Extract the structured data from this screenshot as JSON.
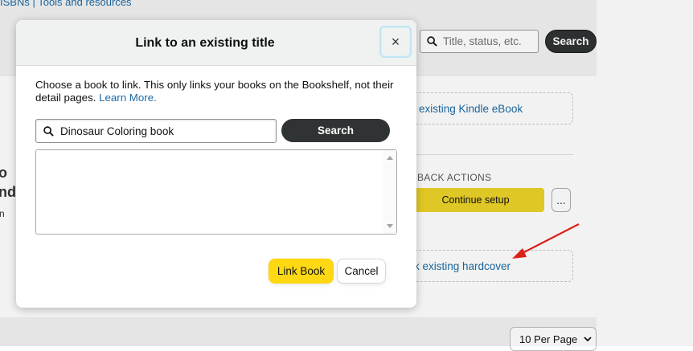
{
  "background": {
    "top_links": "ISBNs | Tools and resources",
    "search_placeholder": "Title, status, etc.",
    "search_button": "Search",
    "link_kindle_label": "existing Kindle eBook",
    "paperback_actions_label": "RBACK ACTIONS",
    "continue_setup_label": "Continue setup",
    "more_label": "...",
    "link_hardcover_label": "k existing hardcover",
    "left_fragment_1": "o",
    "left_fragment_2": "nd",
    "left_fragment_3": "n",
    "per_page_label": "10 Per Page",
    "annotation_color": "#e8231b"
  },
  "modal": {
    "title": "Link to an existing title",
    "close_label": "×",
    "description": "Choose a book to link. This only links your books on the Bookshelf, not their detail pages.",
    "learn_more": "Learn More.",
    "search_value": "Dinosaur Coloring book",
    "search_button": "Search",
    "link_book_button": "Link Book",
    "cancel_button": "Cancel"
  },
  "colors": {
    "primary_yellow": "#ffd814",
    "dark_button": "#303333",
    "link_blue": "#1d6aa5"
  }
}
